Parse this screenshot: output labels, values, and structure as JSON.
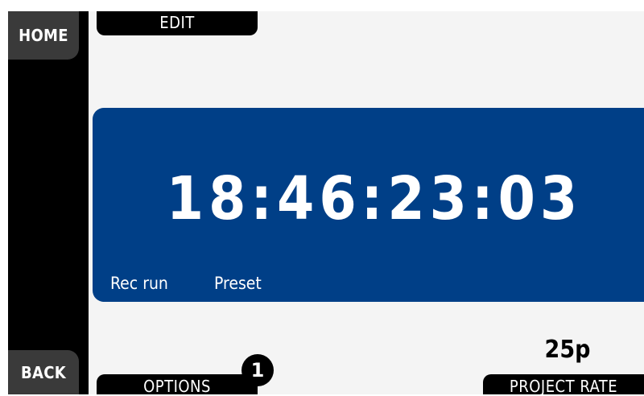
{
  "nav": {
    "home_label": "HOME",
    "back_label": "BACK"
  },
  "tabs": {
    "edit_label": "EDIT",
    "options_label": "OPTIONS",
    "options_badge": "1",
    "project_rate_label": "PROJECT RATE"
  },
  "timecode": {
    "value": "18:46:23:03",
    "mode_label": "Rec run",
    "source_label": "Preset"
  },
  "project": {
    "rate_value": "25p"
  },
  "colors": {
    "panel_background": "#003f87",
    "screen_background": "#f4f4f4",
    "button_background": "#3a3a3a",
    "tab_background": "#000000"
  }
}
